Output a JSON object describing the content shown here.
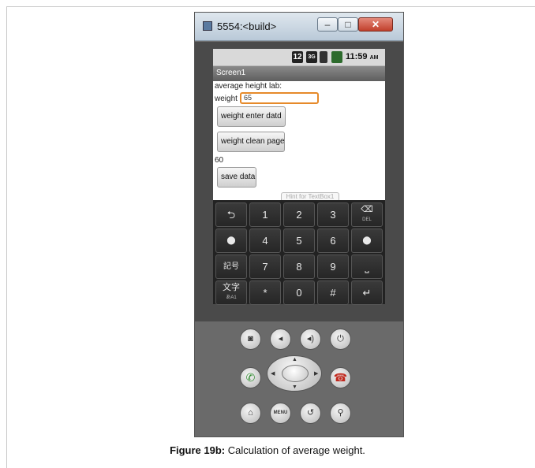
{
  "window": {
    "title": "5554:<build>",
    "minimize": "–",
    "maximize": "□",
    "close": "✕"
  },
  "status_bar": {
    "badge_12": "12",
    "badge_3g": "3G",
    "time": "11:59",
    "ampm": "AM"
  },
  "app": {
    "screen_title": "Screen1",
    "header_label": "average height lab:",
    "weight_label": "weight",
    "weight_value": "65",
    "enter_button": "weight enter datd",
    "clean_button": "weight clean page",
    "result_value": "60",
    "save_button": "save data",
    "hint_textbox": "Hint for TextBox1"
  },
  "keyboard": {
    "row1": [
      "⮌",
      "1",
      "2",
      "3",
      "⌫"
    ],
    "row1_del_sub": "DEL",
    "row2": [
      "⬤",
      "4",
      "5",
      "6",
      "⬤"
    ],
    "row3": [
      "記号",
      "7",
      "8",
      "9",
      "⎵"
    ],
    "row4": [
      "文字",
      "*",
      "0",
      "#",
      "↵"
    ],
    "row4_sub": "あA1"
  },
  "hardware": {
    "menu_label": "MENU"
  },
  "caption": {
    "bold": "Figure 19b:",
    "text": " Calculation of average weight."
  }
}
